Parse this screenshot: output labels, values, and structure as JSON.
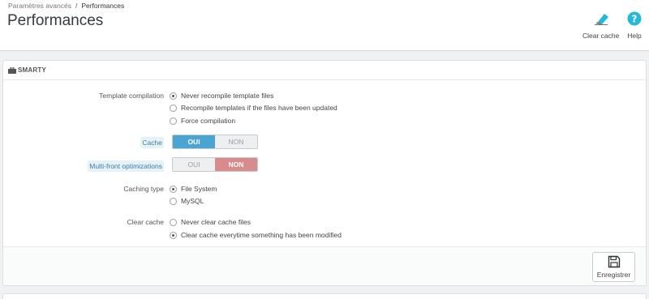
{
  "breadcrumb": {
    "parent": "Paramètres avancés",
    "separator": "/",
    "current": "Performances"
  },
  "page": {
    "title": "Performances"
  },
  "toolbar": {
    "clear_cache_label": "Clear cache",
    "help_label": "Help"
  },
  "panel": {
    "heading": "SMARTY",
    "template_compilation": {
      "label": "Template compilation",
      "options": [
        "Never recompile template files",
        "Recompile templates if the files have been updated",
        "Force compilation"
      ],
      "selected": 0
    },
    "cache": {
      "label": "Cache",
      "on_label": "OUI",
      "off_label": "NON",
      "value": "OUI"
    },
    "multi_front": {
      "label": "Multi-front optimizations",
      "on_label": "OUI",
      "off_label": "NON",
      "value": "NON"
    },
    "caching_type": {
      "label": "Caching type",
      "options": [
        "File System",
        "MySQL"
      ],
      "selected": 0
    },
    "clear_cache": {
      "label": "Clear cache",
      "options": [
        "Never clear cache files",
        "Clear cache everytime something has been modified"
      ],
      "selected": 1
    },
    "save_label": "Enregistrer"
  },
  "colors": {
    "accent_blue": "#4ba5d3",
    "accent_red": "#d98b8c",
    "help_icon": "#25b9d7"
  }
}
